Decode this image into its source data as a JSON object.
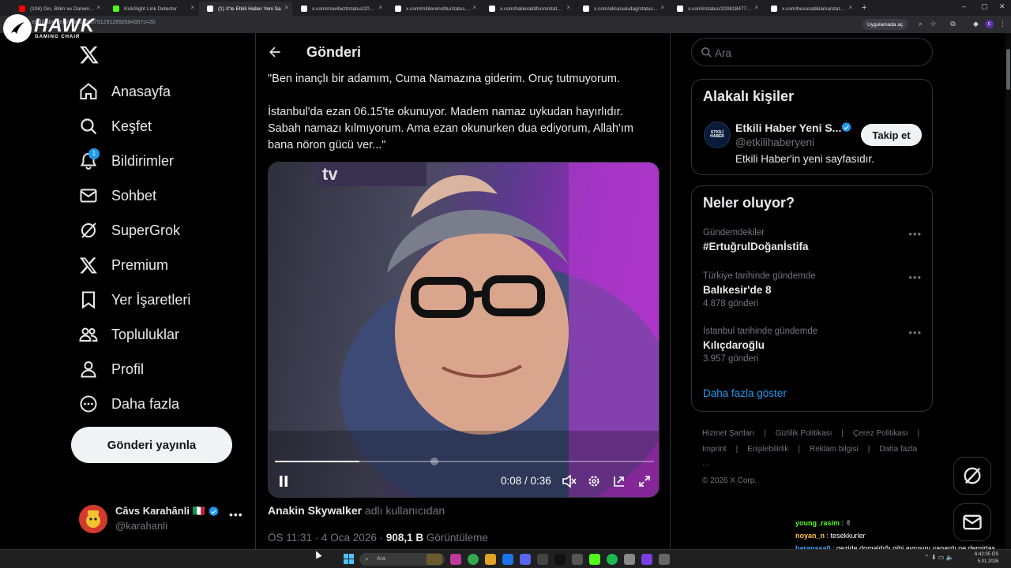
{
  "browser": {
    "tabs": [
      {
        "label": "(108) Din, Bilim ve Darwin - You",
        "favicon_color": "#ff0000"
      },
      {
        "label": "KickSight Link Detector",
        "favicon_color": "#53fc18"
      },
      {
        "label": "(1) X'te Etkili Haber Yeni Sa",
        "favicon_color": "#ffffff",
        "active": true
      },
      {
        "label": "x.com/mavitwzt/status/20079",
        "favicon_color": "#ffffff"
      },
      {
        "label": "x.com/militerenstitu/status/200",
        "favicon_color": "#ffffff"
      },
      {
        "label": "x.com/haberaktifcom/status/20",
        "favicon_color": "#ffffff"
      },
      {
        "label": "x.com/alicanuludag/status/200",
        "favicon_color": "#ffffff"
      },
      {
        "label": "x.com/i/status/2008184770375",
        "favicon_color": "#ffffff"
      },
      {
        "label": "x.com/bosunatiklama/status/20",
        "favicon_color": "#ffffff"
      }
    ],
    "new_tab": "+",
    "url": "etkilihaberyeni/status/2007912912892684357s=20",
    "app_button": "Uygulamada aç"
  },
  "logo": {
    "brand": "HAWK",
    "sub": "GAMING CHAIR"
  },
  "nav": {
    "items": [
      {
        "label": "Anasayfa",
        "icon": "home-icon"
      },
      {
        "label": "Keşfet",
        "icon": "search-icon"
      },
      {
        "label": "Bildirimler",
        "icon": "bell-icon",
        "badge": "1"
      },
      {
        "label": "Sohbet",
        "icon": "mail-icon"
      },
      {
        "label": "SuperGrok",
        "icon": "grok-icon"
      },
      {
        "label": "Premium",
        "icon": "x-icon"
      },
      {
        "label": "Yer İşaretleri",
        "icon": "bookmark-icon"
      },
      {
        "label": "Topluluklar",
        "icon": "communities-icon"
      },
      {
        "label": "Profil",
        "icon": "profile-icon"
      },
      {
        "label": "Daha fazla",
        "icon": "more-circle-icon"
      }
    ],
    "post_button": "Gönderi yayınla"
  },
  "account": {
    "name": "Câvs Karahânli 🇮🇹",
    "handle": "@karahanli",
    "more": "•••"
  },
  "main": {
    "title": "Gönderi",
    "post_paragraphs": [
      "\"Ben inançlı bir adamım, Cuma Namazına giderim. Oruç tutmuyorum.",
      "İstanbul'da ezan 06.15'te okunuyor. Madem namaz uykudan hayırlıdır. Sabah namazı kılmıyorum. Ama ezan okunurken dua ediyorum, Allah'ım bana nöron gücü ver...\""
    ],
    "video": {
      "time": "0:08 / 0:36",
      "progress": 0.222,
      "buffered_knob": 0.41
    },
    "attribution_name": "Anakin Skywalker",
    "attribution_suffix": "adlı kullanıcıdan",
    "meta_time": "ÖS 11:31 · 4 Oca 2026 · ",
    "views": "908,1 B",
    "views_label": " Görüntüleme"
  },
  "search": {
    "placeholder": "Ara"
  },
  "related": {
    "title": "Alakalı kişiler",
    "name": "Etkili Haber Yeni S...",
    "avatar_text": "ETKİLİ HABER",
    "handle": "@etkilihaberyeni",
    "bio": "Etkili Haber'in yeni sayfasıdır.",
    "follow": "Takip et"
  },
  "trends": {
    "title": "Neler oluyor?",
    "items": [
      {
        "context": "Gündemdekiler",
        "name": "#ErtuğrulDoğanİstifa",
        "count": ""
      },
      {
        "context": "Türkiye tarihinde gündemde",
        "name": "Balıkesir'de 8",
        "count": "4.878 gönderi"
      },
      {
        "context": "İstanbul tarihinde gündemde",
        "name": "Kılıçdaroğlu",
        "count": "3.957 gönderi"
      }
    ],
    "more_dots": "•••",
    "show_more": "Daha fazla göster"
  },
  "footer": {
    "line1": [
      "Hizmet Şartları",
      "|",
      "Gizlilik Politikası",
      "|",
      "Çerez Politikası",
      "|"
    ],
    "line2": [
      "Imprint",
      "|",
      "Erişilebilirlik",
      "|",
      "Reklam bilgisi",
      "|",
      "Daha fazla ···"
    ],
    "line3": "© 2026 X Corp."
  },
  "chat": [
    {
      "user": "young_rasim",
      "msg": " : ✌",
      "color": "#53fc18"
    },
    {
      "user": "noyan_n",
      "msg": " : tesekkurler",
      "color": "#ffc34d"
    },
    {
      "user": "baranssa0",
      "msg": " : gezide domaldığı gibi aynısını yapardı oe demirtaş",
      "color": "#3fa7ff"
    }
  ],
  "taskbar": {
    "search": "Ara",
    "time": "6:42:35 ÖS",
    "date": "5.01.2026"
  },
  "colors": {
    "accent": "#1d9bf0",
    "bg": "#000000",
    "border": "#2f3336"
  }
}
